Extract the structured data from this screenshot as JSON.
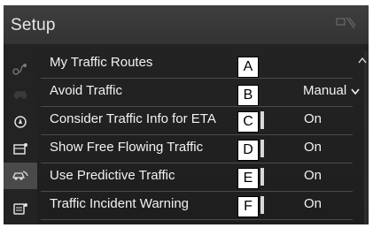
{
  "header": {
    "title": "Setup",
    "corner_icon": "phone-signal-icon"
  },
  "sidebar": {
    "icons": [
      {
        "name": "navigation-route-icon"
      },
      {
        "name": "car-icon"
      },
      {
        "name": "map-info-icon"
      },
      {
        "name": "media-settings-icon"
      },
      {
        "name": "vehicle-traffic-icon",
        "active": true
      },
      {
        "name": "other-settings-icon"
      }
    ]
  },
  "rows": [
    {
      "label": "My Traffic Routes",
      "callout": "A",
      "value": ""
    },
    {
      "label": "Avoid Traffic",
      "callout": "B",
      "value": "Manual"
    },
    {
      "label": "Consider Traffic Info for ETA",
      "callout": "C",
      "value": "On"
    },
    {
      "label": "Show Free Flowing Traffic",
      "callout": "D",
      "value": "On"
    },
    {
      "label": "Use Predictive Traffic",
      "callout": "E",
      "value": "On"
    },
    {
      "label": "Traffic Incident Warning",
      "callout": "F",
      "value": "On"
    }
  ],
  "colors": {
    "panel": "#1e1e1e",
    "header": "#3e3e3e",
    "text": "#f2f2f2",
    "divider": "#4b4b4b"
  }
}
